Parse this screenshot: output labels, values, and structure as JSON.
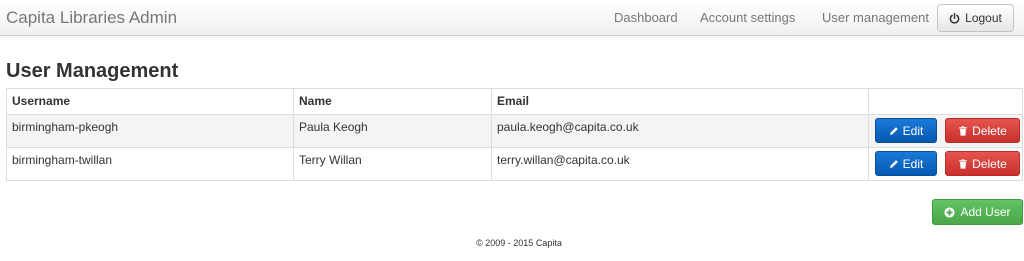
{
  "navbar": {
    "brand": "Capita Libraries Admin",
    "links": [
      "Dashboard",
      "Account settings",
      "User management"
    ],
    "logout_label": "Logout",
    "logout_icon": "power-icon"
  },
  "page": {
    "title": "User Management"
  },
  "table": {
    "columns": [
      "Username",
      "Name",
      "Email",
      ""
    ],
    "rows": [
      {
        "username": "birmingham-pkeogh",
        "name": "Paula Keogh",
        "email": "paula.keogh@capita.co.uk"
      },
      {
        "username": "birmingham-twillan",
        "name": "Terry Willan",
        "email": "terry.willan@capita.co.uk"
      }
    ],
    "edit_label": "Edit",
    "delete_label": "Delete"
  },
  "actions": {
    "add_user_label": "Add User"
  },
  "footer": {
    "text": "© 2009 - 2015 Capita"
  },
  "colors": {
    "edit": "#0a6ad0",
    "delete": "#d9534f",
    "add": "#5cb85c"
  }
}
